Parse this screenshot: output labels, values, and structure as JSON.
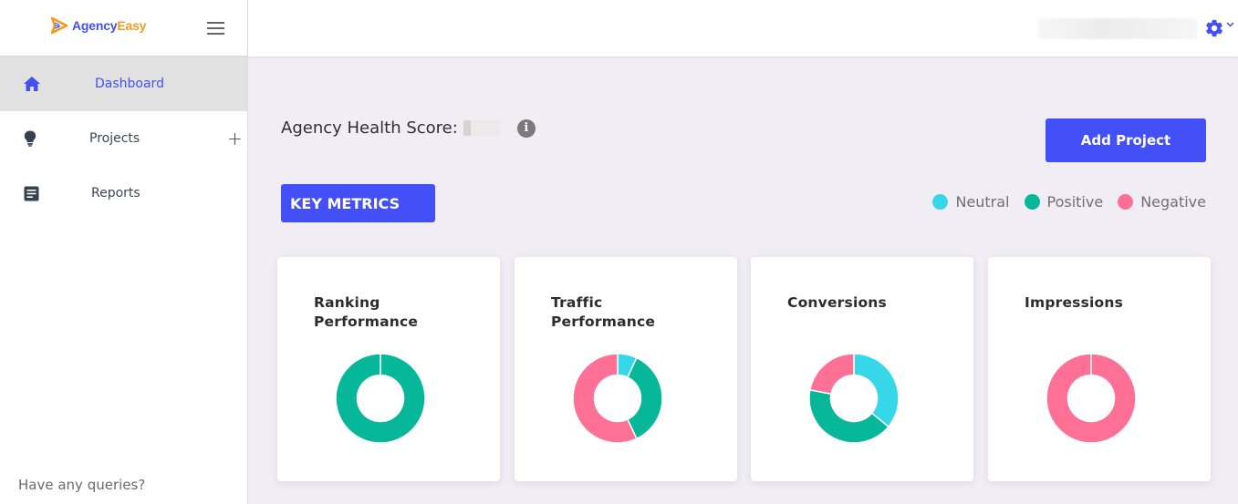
{
  "app": {
    "logo_left": "Agency",
    "logo_right": "Easy"
  },
  "sidebar": {
    "items": [
      {
        "label": "Dashboard",
        "icon": "home-icon",
        "active": true
      },
      {
        "label": "Projects",
        "icon": "lightbulb-icon",
        "active": false,
        "action": "+"
      },
      {
        "label": "Reports",
        "icon": "document-icon",
        "active": false
      }
    ],
    "footer_text": "Have any queries?"
  },
  "header": {
    "settings_icon": "gear-icon",
    "dropdown_icon": "chevron-down-icon"
  },
  "main": {
    "health_label": "Agency Health Score:",
    "info_glyph": "i",
    "add_project_label": "Add Project",
    "section_label": "KEY METRICS",
    "legend": [
      {
        "label": "Neutral",
        "color": "#36d7e8"
      },
      {
        "label": "Positive",
        "color": "#07b79a"
      },
      {
        "label": "Negative",
        "color": "#ff7096"
      }
    ]
  },
  "colors": {
    "accent": "#4450f7",
    "neutral": "#36d7e8",
    "positive": "#07b79a",
    "negative": "#ff7096"
  },
  "chart_data": [
    {
      "type": "pie",
      "title": "Ranking Performance",
      "categories": [
        "Neutral",
        "Positive",
        "Negative"
      ],
      "values": [
        0,
        100,
        0
      ],
      "unit": "percent"
    },
    {
      "type": "pie",
      "title": "Traffic Performance",
      "categories": [
        "Neutral",
        "Positive",
        "Negative"
      ],
      "values": [
        7,
        36,
        57
      ],
      "unit": "percent"
    },
    {
      "type": "pie",
      "title": "Conversions",
      "categories": [
        "Neutral",
        "Positive",
        "Negative"
      ],
      "values": [
        36,
        42,
        22
      ],
      "unit": "percent"
    },
    {
      "type": "pie",
      "title": "Impressions",
      "categories": [
        "Neutral",
        "Positive",
        "Negative"
      ],
      "values": [
        0,
        0,
        100
      ],
      "unit": "percent"
    }
  ]
}
